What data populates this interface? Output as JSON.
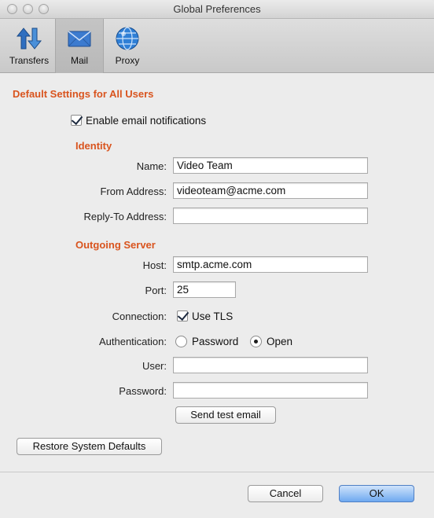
{
  "window": {
    "title": "Global Preferences"
  },
  "toolbar": {
    "items": [
      {
        "label": "Transfers",
        "icon": "transfers-icon",
        "selected": false
      },
      {
        "label": "Mail",
        "icon": "mail-icon",
        "selected": true
      },
      {
        "label": "Proxy",
        "icon": "proxy-globe-icon",
        "selected": false
      }
    ]
  },
  "section": {
    "title": "Default Settings for All Users"
  },
  "enable_notifications": {
    "label": "Enable email notifications",
    "checked": true
  },
  "identity": {
    "title": "Identity",
    "name_label": "Name:",
    "name_value": "Video Team",
    "from_label": "From Address:",
    "from_value": "videoteam@acme.com",
    "replyto_label": "Reply-To Address:",
    "replyto_value": ""
  },
  "server": {
    "title": "Outgoing Server",
    "host_label": "Host:",
    "host_value": "smtp.acme.com",
    "port_label": "Port:",
    "port_value": "25",
    "connection_label": "Connection:",
    "tls_label": "Use TLS",
    "tls_checked": true,
    "auth_label": "Authentication:",
    "auth_options": [
      "Password",
      "Open"
    ],
    "auth_selected": "Open",
    "user_label": "User:",
    "user_value": "",
    "password_label": "Password:",
    "password_value": "",
    "test_button": "Send test email"
  },
  "restore_button": "Restore System Defaults",
  "footer": {
    "cancel": "Cancel",
    "ok": "OK"
  },
  "colors": {
    "section_title": "#d9541e",
    "ok_button": "#6fa9f0"
  }
}
